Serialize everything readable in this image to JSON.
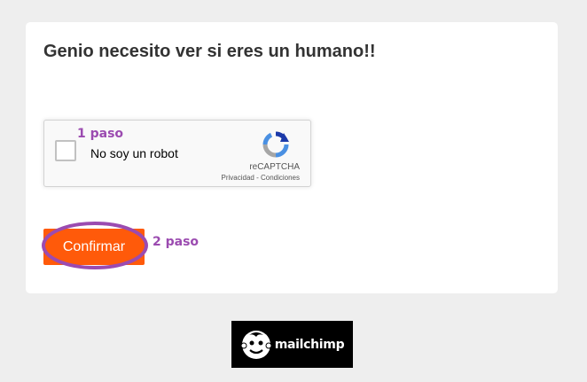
{
  "form": {
    "title": "Genio necesito ver si eres un humano!!",
    "recaptcha": {
      "checkbox_label": "No soy un robot",
      "brand": "reCAPTCHA",
      "privacy_link": "Privacidad",
      "separator": " - ",
      "terms_link": "Condiciones",
      "icon": "recaptcha-logo-icon"
    },
    "submit_label": "Confirmar"
  },
  "annotations": {
    "step1": "1 paso",
    "step2": "2 paso"
  },
  "footer": {
    "badge_text": "mailchimp",
    "icon": "mailchimp-freddie-icon"
  },
  "colors": {
    "page_bg": "#eeeeee",
    "card_bg": "#ffffff",
    "button_bg": "#ff5a0a",
    "annotation": "#9b4bb0",
    "badge_bg": "#000000"
  }
}
